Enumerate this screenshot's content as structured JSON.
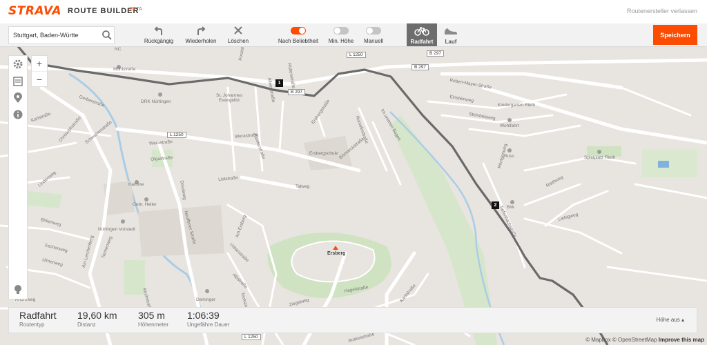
{
  "header": {
    "logo": "STRAVA",
    "product": "ROUTE BUILDER",
    "badge": "BETA",
    "exit_link": "Routenersteller verlassen"
  },
  "toolbar": {
    "search_value": "Stuttgart, Baden-Württe",
    "undo": "Rückgängig",
    "redo": "Wiederholen",
    "clear": "Löschen",
    "popularity": "Nach Beliebtheit",
    "min_elevation": "Min. Höhe",
    "manual": "Manuell",
    "ride": "Radfahrt",
    "run": "Lauf",
    "save": "Speichern",
    "accent": "#fc4c02"
  },
  "map": {
    "labels": {
      "l1250a": "L 1250",
      "l1250b": "L 1250",
      "l1250c": "L 1250",
      "b297a": "B 297",
      "b297b": "B 297",
      "b297c": "B 297",
      "nc": "NC",
      "mill": "Mühlstraße",
      "drk": "DRK Nürtingen",
      "st": "St. Johannes Evangelist",
      "forst": "Forststraße",
      "alleen": "Alleenstraße",
      "ersberg": "Ersbergstraße",
      "ruetlen": "Rütlenstraße",
      "ruem": "Rümelinstraße",
      "bismarck": "Bismarckstraße",
      "imunteren": "Im unteren Bogen",
      "robert": "Robert-Mayer-Straße",
      "einstein": "Einsteinweg",
      "steinbeis": "Steinbeisweg",
      "kindergarten": "Kindergarten Rieth",
      "wohlfahrt": "Wohlfahrt",
      "russ": "Russ",
      "spielplatz": "Spielplatz Rieth",
      "roentgen": "Röntgenweg",
      "tiefenbach": "Tiefenbachstraße",
      "riethweg": "Riethweg",
      "birk": "Birk",
      "liebig": "Liebigweg",
      "ersbergschule": "Ersbergschule",
      "weras": "Werastraße",
      "olga": "Olgastraße",
      "liststr": "Liststraße",
      "kanone": "Kanone",
      "gebr": "Gebr. Heller",
      "neuffener": "Neuffener Straße",
      "am_ersberg": "Am Ersberg",
      "urbanstr": "Urbanstraße",
      "albstr": "Albstraße",
      "hagel": "Hagelstraße",
      "kant": "Kantstraße",
      "ersberg_peak": "Ersberg",
      "nuertingen_vorstadt": "Nürtingen Vorstadt",
      "deminger": "Deminger",
      "brakes": "Brakesstraße",
      "gerber": "Gerberstraße",
      "karl": "Karlstraße",
      "christoph": "Christophstraße",
      "schwaben": "Schwabenstraße",
      "eschen": "Eschenweg",
      "ulmen": "Ulmenweg",
      "birken": "Birkenweg",
      "linden": "Lindenweg",
      "am_lerchenberg": "Am Lerchenberg",
      "tannen": "Tannenweg",
      "ahorn": "Ahornweg",
      "kirch": "Kirchstraße",
      "drival": "Drivalweg",
      "werastr2": "Werastraße",
      "kloster": "Klosterstraße",
      "talweg": "Talweg",
      "teck": "Teckstraße",
      "ziegel": "Ziegelweg"
    },
    "markers": [
      "1",
      "2"
    ]
  },
  "stats": {
    "type_value": "Radfahrt",
    "type_label": "Routentyp",
    "distance_value": "19,60 km",
    "distance_label": "Distanz",
    "elevation_value": "305 m",
    "elevation_label": "Höhenmeter",
    "time_value": "1:06:39",
    "time_label": "Ungefähre Dauer",
    "elevation_toggle": "Höhe aus"
  },
  "attribution": {
    "mapbox": "© Mapbox",
    "osm": "© OpenStreetMap",
    "improve": "Improve this map"
  }
}
